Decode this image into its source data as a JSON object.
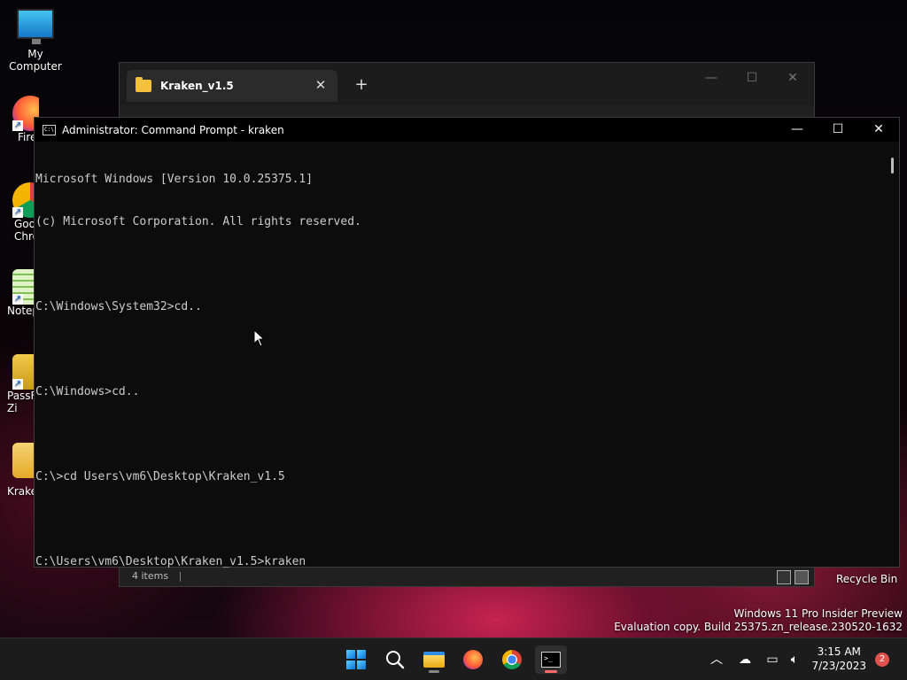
{
  "desktop": {
    "icons": [
      {
        "label": "My Computer"
      },
      {
        "label": "Fire"
      },
      {
        "label": "Goo Chro"
      },
      {
        "label": "Notep"
      },
      {
        "label": "PassF Zi"
      },
      {
        "label": "Kraker"
      }
    ],
    "recycle_bin_label": "Recycle Bin",
    "watermark_line1": "Windows 11 Pro Insider Preview",
    "watermark_line2": "Evaluation copy. Build 25375.zn_release.230520-1632"
  },
  "explorer": {
    "tab_label": "Kraken_v1.5",
    "status_text": "4 items"
  },
  "cmd": {
    "title": "Administrator: Command Prompt - kraken",
    "lines": [
      "Microsoft Windows [Version 10.0.25375.1]",
      "(c) Microsoft Corporation. All rights reserved.",
      "",
      "C:\\Windows\\System32>cd..",
      "",
      "C:\\Windows>cd..",
      "",
      "C:\\>cd Users\\vm6\\Desktop\\Kraken_v1.5",
      "",
      "C:\\Users\\vm6\\Desktop\\Kraken_v1.5>kraken"
    ]
  },
  "taskbar": {
    "time": "3:15 AM",
    "date": "7/23/2023",
    "notification_count": "2"
  },
  "colors": {
    "accent": "#0a74d9",
    "folder": "#f3c13a",
    "console_text": "#cccccc"
  }
}
